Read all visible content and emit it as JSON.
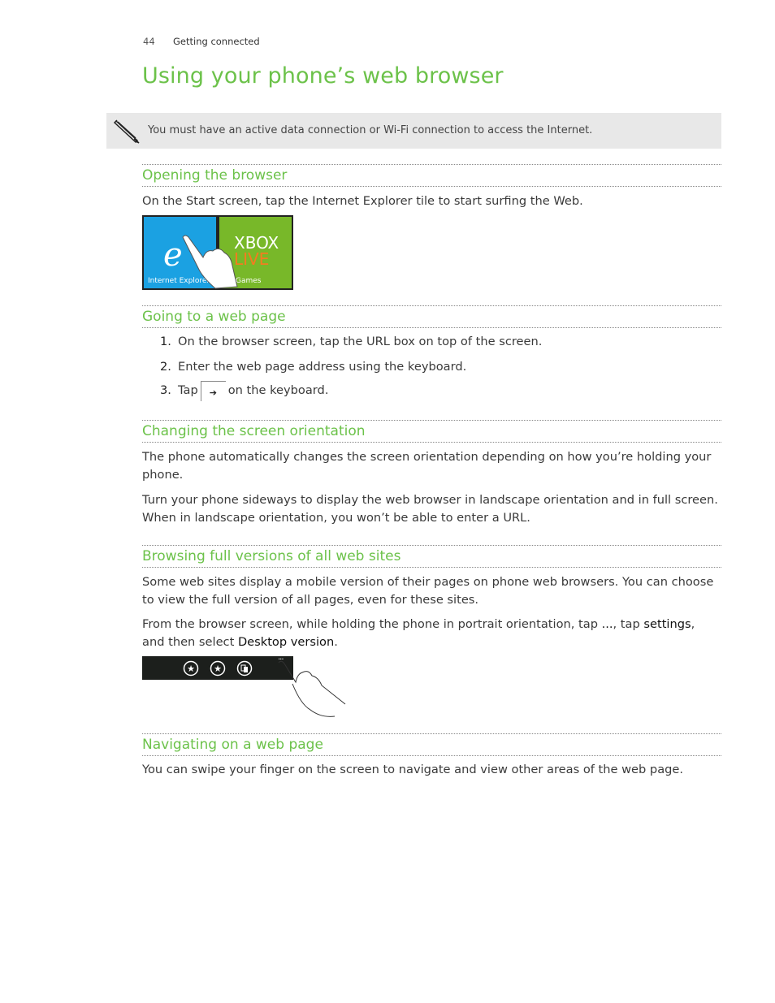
{
  "header": {
    "page_number": "44",
    "chapter": "Getting connected"
  },
  "title": "Using your phone’s web browser",
  "note": {
    "icon": "pencil-icon",
    "text": "You must have an active data connection or Wi-Fi connection to access the Internet."
  },
  "sections": [
    {
      "heading": "Opening the browser",
      "paragraphs": [
        "On the Start screen, tap the Internet Explorer tile to start surfing the Web."
      ],
      "image": {
        "tiles": [
          {
            "label": "Internet Explorer",
            "color": "#1ba1e2"
          },
          {
            "label": "Games",
            "logo": "XBOX LIVE",
            "color": "#78b829"
          }
        ]
      }
    },
    {
      "heading": "Going to a web page",
      "steps": [
        {
          "num": "1.",
          "text": "On the browser screen, tap the URL box on top of the screen."
        },
        {
          "num": "2.",
          "text": "Enter the web page address using the keyboard."
        },
        {
          "num": "3.",
          "pre": "Tap",
          "key_icon": "arrow-right-icon",
          "post": "on the keyboard."
        }
      ]
    },
    {
      "heading": "Changing the screen orientation",
      "paragraphs": [
        "The phone automatically changes the screen orientation depending on how you’re holding your phone.",
        "Turn your phone sideways to display the web browser in landscape orientation and in full screen. When in landscape orientation, you won’t be able to enter a URL."
      ]
    },
    {
      "heading": "Browsing full versions of all web sites",
      "paragraphs": [
        "Some web sites display a mobile version of their pages on phone web browsers. You can choose to view the full version of all pages, even for these sites."
      ],
      "instruction": {
        "p1": "From the browser screen, while holding the phone in portrait orientation, tap",
        "more": "...",
        "p2": ", tap",
        "settings": "settings",
        "p3": ",",
        "p4": "and then select",
        "desktop": "Desktop version",
        "p5": "."
      },
      "appbar_icons": [
        "add-favorite-icon",
        "favorites-icon",
        "tabs-icon",
        "more-icon"
      ]
    },
    {
      "heading": "Navigating on a web page",
      "paragraphs": [
        "You can swipe your finger on the screen to navigate and view other areas of the web page."
      ]
    }
  ]
}
